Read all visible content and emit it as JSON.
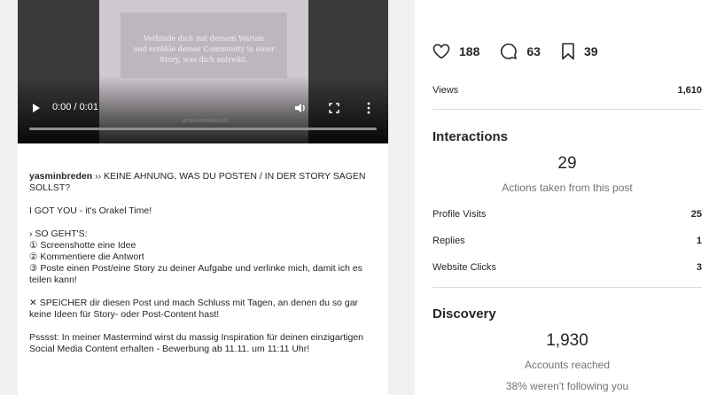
{
  "video": {
    "caption": "Verbinde dich mit deinem Warum\nund erzähle deiner Community in einer\nStory, was dich antreibt.",
    "watermark": "@YASMINBREDEN",
    "time": "0:00 / 0:01"
  },
  "post": {
    "username": "yasminbreden",
    "title_text": " ›› KEINE AHNUNG, WAS DU POSTEN / IN DER STORY SAGEN SOLLST?",
    "line2": "I GOT YOU - it's Orakel Time!",
    "steps_header": "› SO GEHT'S:",
    "step1": "① Screenshotte eine Idee",
    "step2": "② Kommentiere die Antwort",
    "step3": "③ Poste einen Post/eine Story zu deiner Aufgabe und verlinke mich, damit ich es teilen kann!",
    "save_note": "✕ SPEICHER dir diesen Post und mach Schluss mit Tagen, an denen du so gar keine Ideen für Story- oder Post-Content hast!",
    "psst": "Psssst: In meiner Mastermind wirst du massig Inspiration für deinen einzigartigen Social Media Content erhalten - Bewerbung ab 11.11. um 11:11 Uhr!"
  },
  "stats": {
    "likes": "188",
    "comments": "63",
    "saves": "39"
  },
  "views": {
    "label": "Views",
    "value": "1,610"
  },
  "interactions": {
    "title": "Interactions",
    "total": "29",
    "subtitle": "Actions taken from this post",
    "rows": [
      {
        "label": "Profile Visits",
        "value": "25"
      },
      {
        "label": "Replies",
        "value": "1"
      },
      {
        "label": "Website Clicks",
        "value": "3"
      }
    ]
  },
  "discovery": {
    "title": "Discovery",
    "total": "1,930",
    "subtitle": "Accounts reached",
    "note": "38% weren't following you"
  },
  "icons": {
    "like": "heart-icon",
    "comment": "comment-icon",
    "save": "bookmark-icon",
    "play": "play-icon",
    "volume": "volume-icon",
    "fullscreen": "fullscreen-icon",
    "more": "more-vertical-icon"
  },
  "colors": {
    "background": "#f1f1f3",
    "text": "#262626",
    "muted": "#737373",
    "divider": "#dbdbdb"
  }
}
